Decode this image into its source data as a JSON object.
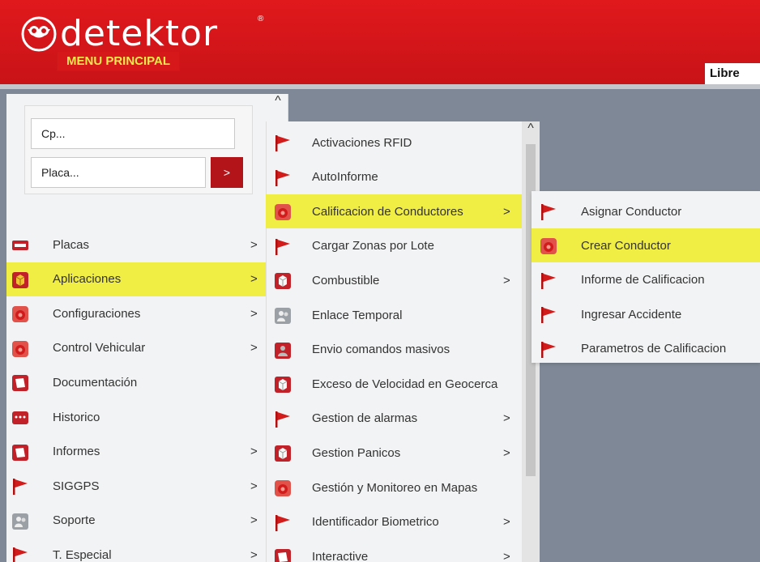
{
  "header": {
    "logo_text": "detektor",
    "logo_reg": "®",
    "menu_label": "MENU PRINCIPAL",
    "right_label": "Libre"
  },
  "search": {
    "cp_placeholder": "Cp...",
    "placa_placeholder": "Placa...",
    "go_label": ">"
  },
  "scroll_up_glyph": "^",
  "left_menu": [
    {
      "label": "Placas",
      "icon": "plate-icon",
      "arrow": ">"
    },
    {
      "label": "Aplicaciones",
      "icon": "box-icon",
      "arrow": ">",
      "highlighted": true
    },
    {
      "label": "Configuraciones",
      "icon": "gear-red-icon",
      "arrow": ">"
    },
    {
      "label": "Control Vehicular",
      "icon": "gear-red-icon",
      "arrow": ">"
    },
    {
      "label": "Documentación",
      "icon": "document-icon",
      "arrow": ""
    },
    {
      "label": "Historico",
      "icon": "dots-icon",
      "arrow": ""
    },
    {
      "label": "Informes",
      "icon": "document-icon",
      "arrow": ">"
    },
    {
      "label": "SIGGPS",
      "icon": "flag-icon",
      "arrow": ">"
    },
    {
      "label": "Soporte",
      "icon": "people-icon",
      "arrow": ">"
    },
    {
      "label": "T. Especial",
      "icon": "flag-icon",
      "arrow": ">"
    }
  ],
  "sub_menu": [
    {
      "label": "Activaciones RFID",
      "icon": "flag-icon",
      "arrow": ""
    },
    {
      "label": "AutoInforme",
      "icon": "flag-icon",
      "arrow": ""
    },
    {
      "label": "Calificacion de Conductores",
      "icon": "gear-red-icon",
      "arrow": ">",
      "highlighted": true
    },
    {
      "label": "Cargar Zonas por Lote",
      "icon": "flag-icon",
      "arrow": ""
    },
    {
      "label": "Combustible",
      "icon": "box-red-icon",
      "arrow": ">"
    },
    {
      "label": "Enlace Temporal",
      "icon": "people-icon",
      "arrow": ""
    },
    {
      "label": "Envio comandos masivos",
      "icon": "people-red-icon",
      "arrow": ""
    },
    {
      "label": "Exceso de Velocidad en Geocerca",
      "icon": "box-red-icon",
      "arrow": ""
    },
    {
      "label": "Gestion de alarmas",
      "icon": "flag-icon",
      "arrow": ">"
    },
    {
      "label": "Gestion Panicos",
      "icon": "box-red-icon",
      "arrow": ">"
    },
    {
      "label": "Gestión y Monitoreo en Mapas",
      "icon": "gear-red-icon",
      "arrow": ""
    },
    {
      "label": "Identificador Biometrico",
      "icon": "flag-icon",
      "arrow": ">"
    },
    {
      "label": "Interactive",
      "icon": "document-icon",
      "arrow": ">"
    }
  ],
  "sub_sub_menu": [
    {
      "label": "Asignar Conductor",
      "icon": "flag-icon"
    },
    {
      "label": "Crear Conductor",
      "icon": "gear-red-icon",
      "highlighted": true
    },
    {
      "label": "Informe de Calificacion",
      "icon": "flag-icon"
    },
    {
      "label": "Ingresar Accidente",
      "icon": "flag-icon"
    },
    {
      "label": "Parametros de Calificacion",
      "icon": "flag-icon"
    }
  ],
  "colors": {
    "header_red": "#d6181b",
    "highlight_yellow": "#f0ed45",
    "menu_bg": "#f2f3f4",
    "desktop_gray": "#7f8896"
  }
}
